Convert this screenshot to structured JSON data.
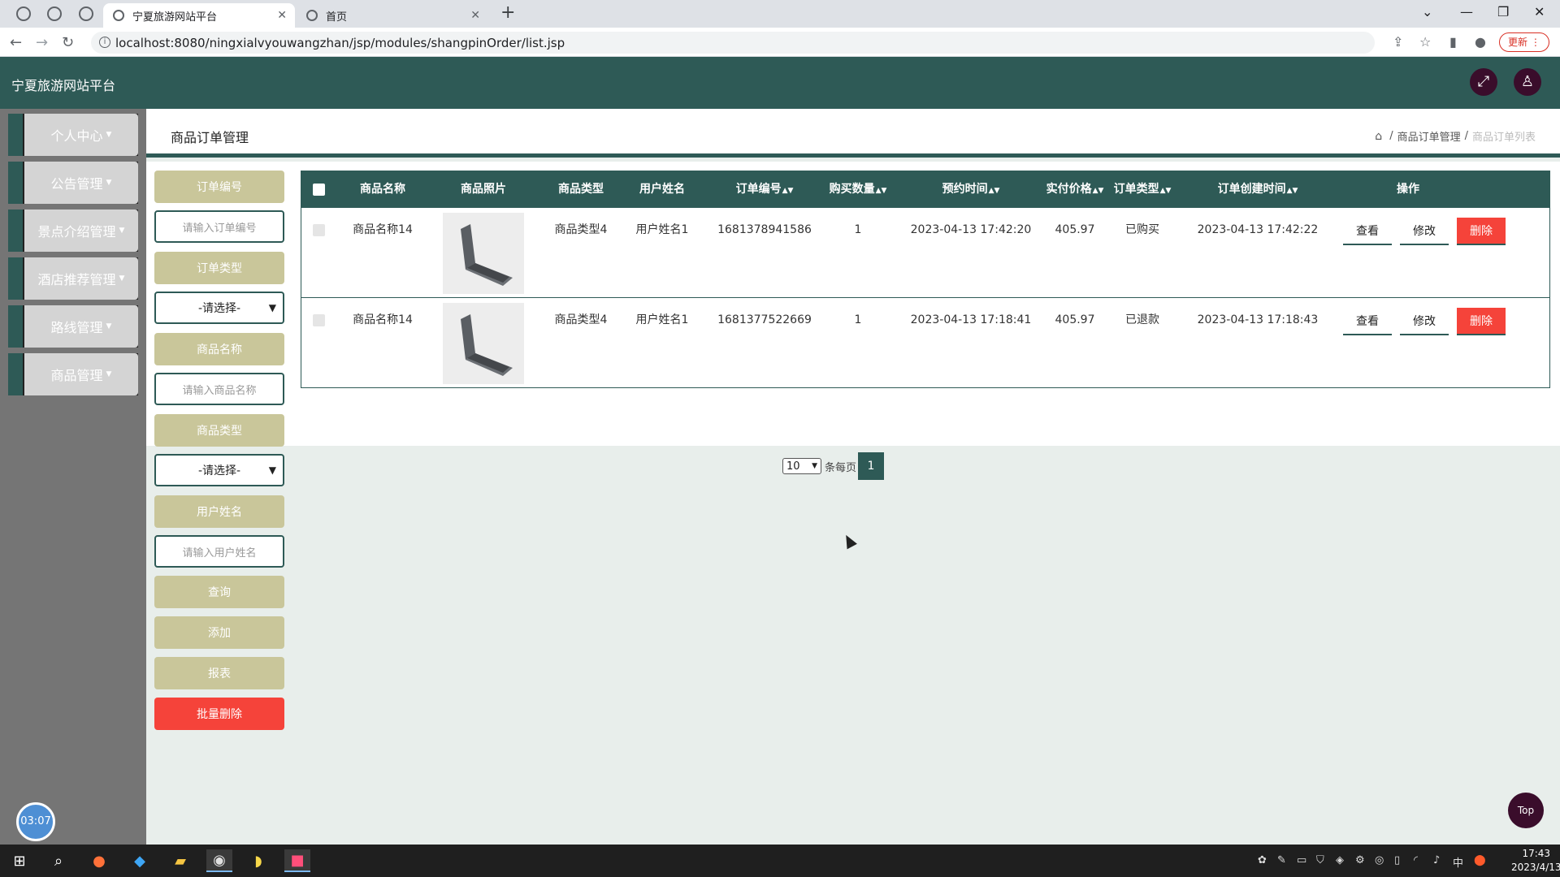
{
  "browser": {
    "tabs": [
      {
        "title": "宁夏旅游网站平台",
        "active": true
      },
      {
        "title": "首页",
        "active": false
      }
    ],
    "url": "localhost:8080/ningxialvyouwangzhan/jsp/modules/shangpinOrder/list.jsp",
    "update_label": "更新"
  },
  "app": {
    "title": "宁夏旅游网站平台"
  },
  "sidebar": {
    "items": [
      {
        "label": "个人中心"
      },
      {
        "label": "公告管理"
      },
      {
        "label": "景点介绍管理"
      },
      {
        "label": "酒店推荐管理"
      },
      {
        "label": "路线管理"
      },
      {
        "label": "商品管理"
      }
    ],
    "clock": "03:07"
  },
  "page": {
    "title": "商品订单管理",
    "breadcrumb": [
      "商品订单管理",
      "商品订单列表"
    ]
  },
  "filters": {
    "order_no_label": "订单编号",
    "order_no_placeholder": "请输入订单编号",
    "order_type_label": "订单类型",
    "order_type_select": "-请选择-",
    "product_name_label": "商品名称",
    "product_name_placeholder": "请输入商品名称",
    "product_type_label": "商品类型",
    "product_type_select": "-请选择-",
    "user_name_label": "用户姓名",
    "user_name_placeholder": "请输入用户姓名",
    "search_label": "查询",
    "add_label": "添加",
    "report_label": "报表",
    "batch_delete_label": "批量删除"
  },
  "table": {
    "headers": [
      "商品名称",
      "商品照片",
      "商品类型",
      "用户姓名",
      "订单编号",
      "购买数量",
      "预约时间",
      "实付价格",
      "订单类型",
      "订单创建时间",
      "操作"
    ],
    "rows": [
      {
        "name": "商品名称14",
        "type": "商品类型4",
        "user": "用户姓名1",
        "order_no": "1681378941586",
        "qty": "1",
        "reserve_time": "2023-04-13 17:42:20",
        "price": "405.97",
        "order_type": "已购买",
        "created": "2023-04-13 17:42:22"
      },
      {
        "name": "商品名称14",
        "type": "商品类型4",
        "user": "用户姓名1",
        "order_no": "1681377522669",
        "qty": "1",
        "reserve_time": "2023-04-13 17:18:41",
        "price": "405.97",
        "order_type": "已退款",
        "created": "2023-04-13 17:18:43"
      }
    ],
    "actions": {
      "view": "查看",
      "edit": "修改",
      "delete": "删除"
    }
  },
  "pager": {
    "page_size": "10",
    "per_page_label": "条每页",
    "current_page": "1"
  },
  "top_label": "Top",
  "taskbar": {
    "time": "17:43",
    "date": "2023/4/13",
    "ime": "中"
  },
  "colors": {
    "primary": "#2e5a56",
    "filter_button": "#c9c69a",
    "danger": "#f5433a"
  }
}
